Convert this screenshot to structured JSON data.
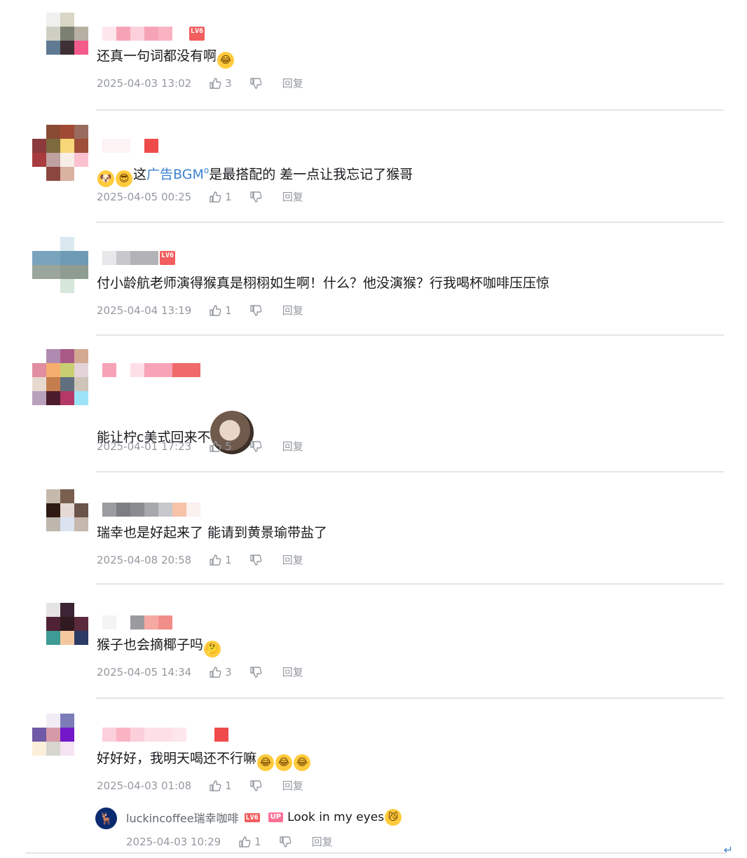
{
  "colors": {
    "accent_link": "#3c82cf",
    "meta_gray": "#9499a0",
    "divider": "#e3e5e7",
    "level_badge": "#f25d5d",
    "up_badge": "#fb7299"
  },
  "comments": [
    {
      "level": "LV6",
      "text": "还真一句词都没有啊",
      "emoji_after": "laugh-cry",
      "time": "2025-04-03 13:02",
      "likes": "3",
      "reply_label": "回复"
    },
    {
      "level": "",
      "text_before": "这",
      "link": "广告BGM",
      "link_icon": "search-mark",
      "text_after": "是最搭配的 差一点让我忘记了猴哥",
      "emoji_before": [
        "doge",
        "sunglasses"
      ],
      "time": "2025-04-05 00:25",
      "likes": "1",
      "reply_label": "回复"
    },
    {
      "level": "LV6",
      "text": "付小龄航老师演得猴真是栩栩如生啊！什么？他没演猴？行我喝杯咖啡压压惊",
      "time": "2025-04-04 13:19",
      "likes": "1",
      "reply_label": "回复"
    },
    {
      "level": "",
      "text": "能让柠c美式回来不",
      "sticker_after": "anime-girl-sticker",
      "time": "2025-04-01 17:23",
      "likes": "5",
      "reply_label": "回复"
    },
    {
      "level": "",
      "text": "瑞幸也是好起来了 能请到黄景瑜带盐了",
      "time": "2025-04-08 20:58",
      "likes": "1",
      "reply_label": "回复"
    },
    {
      "level": "",
      "text": "猴子也会摘椰子吗",
      "emoji_after": "thinking",
      "time": "2025-04-05 14:34",
      "likes": "3",
      "reply_label": "回复"
    },
    {
      "level": "",
      "text": "好好好，我明天喝还不行嘛",
      "emoji_after": "laugh-cry-x3",
      "time": "2025-04-03 01:08",
      "likes": "1",
      "reply_label": "回复"
    }
  ],
  "reply": {
    "name": "luckincoffee瑞幸咖啡",
    "level": "LV6",
    "up_badge": "UP",
    "text": "Look in my eyes",
    "emoji_after": "cat-smirk",
    "time": "2025-04-03 10:29",
    "likes": "1",
    "reply_label": "回复"
  },
  "corner_glyph": "↵"
}
